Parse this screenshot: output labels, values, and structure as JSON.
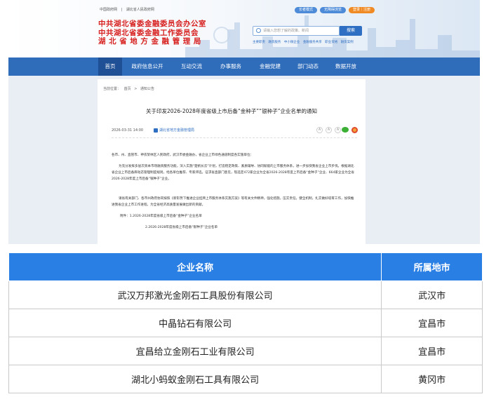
{
  "top_links": [
    "中国政府网",
    "|",
    "湖北省人民政府网"
  ],
  "top_pills": [
    {
      "label": "长者模式",
      "color": "#4d8bd8"
    },
    {
      "label": "无障碍浏览",
      "color": "#4d8bd8"
    },
    {
      "label": "登录｜注册",
      "color": "#f08a24"
    }
  ],
  "brand": {
    "line1": "中共湖北省委金融委员会办公室",
    "line2": "中共湖北省委金融工作委员会",
    "line3": "湖北省地方金融管理局"
  },
  "search": {
    "placeholder": "请输入您想了解的政策、新闻",
    "button": "搜索"
  },
  "hot_links": [
    "主要职责",
    "融资服务",
    "中小微企业",
    "金融服务共享",
    "职业资格",
    "融资案例"
  ],
  "nav": [
    "首页",
    "政府信息公开",
    "互动交流",
    "办事服务",
    "金融党建",
    "部门动态",
    "数据开放"
  ],
  "nav_active_index": 0,
  "article": {
    "breadcrumb": [
      "当前位置：",
      "首页",
      ">",
      "通知公告"
    ],
    "title": "关于印发2026-2028年度省级上市后备“金种子”“银种子”企业名单的通知",
    "date": "2026-03-31 14:00",
    "source": "湖北省地方金融管理局",
    "font_sizes": [
      "A",
      "A",
      "A"
    ],
    "salutation": "各市、州、直管市、神农架林区人民政府，武汉市委金融办，省企业上市绿色通道制度各实施单位：",
    "para1": "为充分发挥多层次资本市场融资服务功能，深入实施“楚帆长云”计划，打造稳定政策、素质辅导、协同赋能的上市服务体系，进一步加快我省企业上市步伐。根据湖北省企业上市后备库动态管理制度规则，经各单位推荐、专家评选，征求省直部门意见，现选定472家企业为全省2026-2028年度上市后备“金种子”企业、664家企业为全省2026-2028年度上市后备“银种子”企业。",
    "para2": "请省有关部门、各市州政府协同按照《新形势下推进企业挂牌上市服务体系实施方案》等有关文件精神，强化措施，压实责任，健全机制，扎实做好培育工作，加快推进我省企业上市工作进程，为全省经济高质量发展做出新的贡献。",
    "attach1": "附件：1.2026-2028年度省级上市后备“金种子”企业名单",
    "attach2": "2.2026-2028年度省级上市后备“银种子”企业名单"
  },
  "table": {
    "headers": [
      "企业名称",
      "所属地市"
    ],
    "rows": [
      [
        "武汉万邦激光金刚石工具股份有限公司",
        "武汉市"
      ],
      [
        "中晶钻石有限公司",
        "宜昌市"
      ],
      [
        "宜昌给立金刚石工业有限公司",
        "宜昌市"
      ],
      [
        "湖北小蚂蚁金刚石工具有限公司",
        "黄冈市"
      ]
    ]
  },
  "colors": {
    "brand_red": "#d7201f",
    "nav_blue": "#2f6dbb",
    "table_header": "#2a7fe4"
  }
}
